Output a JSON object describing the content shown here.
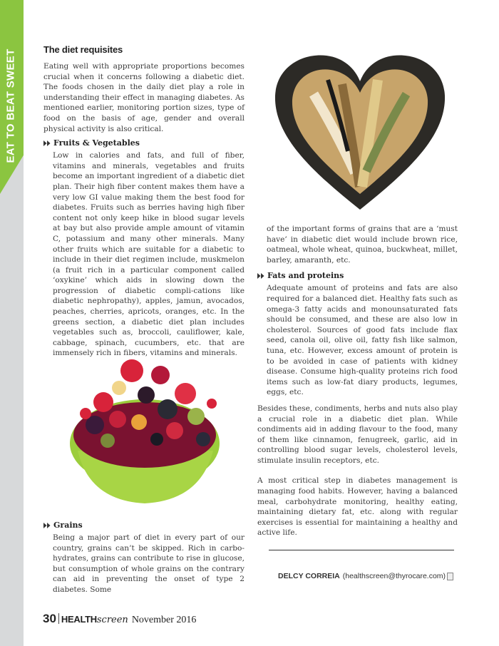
{
  "sidebar": {
    "label": "EAT TO BEAT SWEET",
    "accent_color": "#8bc540",
    "band_color": "#d7d9da"
  },
  "article": {
    "heading": "The diet requisites",
    "intro": "Eating well with appropriate proportions becomes crucial when it concerns following a diabetic diet. The foods chosen in the daily diet play a role in understanding their effect in managing diabetes. As mentioned earlier, monitoring portion sizes, type of food on the basis of age, gender and overall physical activity is also critical.",
    "fruits": {
      "title": "Fruits & Vegetables",
      "body": "Low in calories and fats, and full of fiber, vitamins and minerals, vegetables and fruits become an important ingredient of a diabetic diet plan. Their high fiber content makes them have a very low GI value making them the best food for diabetes. Fruits such as berries having high fiber content not only keep hike in blood sugar levels at bay but also provide ample amount of vitamin C, potassium and many other minerals. Many other fruits which are suitable for a diabetic to include in their diet regimen include, muskmelon (a fruit rich in a particular component called ‘oxykine’ which aids in slowing down the progression of diabetic compli-cations like diabetic nephropathy), apples, jamun, avocados, peaches, cherries, apricots, oranges, etc. In the greens section, a diabetic diet plan includes vegetables such as, broccoli, cauliflower, kale, cabbage, spinach, cucumbers, etc. that are immensely rich in fibers, vitamins and minerals."
    },
    "grains": {
      "title": "Grains",
      "body_left": "Being a major part of diet in every part of our country, grains can’t be skipped. Rich in carbo-hydrates, grains can contribute to rise in glucose, but consumption of whole grains on the contrary can aid in preventing the onset of type 2 diabetes. Some",
      "body_right": "of the important forms of grains that are a ‘must have’ in diabetic diet would include brown rice, oatmeal, whole wheat, quinoa, buckwheat, millet, barley, amaranth, etc."
    },
    "fats": {
      "title": "Fats and proteins",
      "body": "Adequate amount of proteins and fats are also required for a balanced diet. Healthy fats such as omega-3 fatty acids and monounsaturated fats should be consumed, and these are also low in cholesterol. Sources of good fats include flax seed, canola oil, olive oil, fatty fish like salmon, tuna, etc. However, excess amount of protein is to be avoided in case of patients with kidney disease. Consume high-quality proteins rich food items such as low-fat diary products, legumes, eggs, etc."
    },
    "condiments": "Besides these, condiments, herbs and nuts also play a crucial role in a diabetic diet plan. While condiments aid in adding flavour to the food, many of them like cinnamon, fenugreek, garlic, aid in controlling blood sugar levels, cholesterol levels, stimulate insulin receptors, etc.",
    "closing": "A most critical step in diabetes management is managing food habits. However, having a balanced meal, carbohydrate monitoring, healthy eating, maintaining dietary fat, etc. along with regular exercises is essential for maintaining a healthy and active life.",
    "author_name": "DELCY CORREIA",
    "author_email": "(healthscreen@thyrocare.com)"
  },
  "footer": {
    "page_number": "30",
    "magazine_bold": "HEALTH",
    "magazine_script": "screen",
    "issue": "November 2016"
  },
  "icons": {
    "bullet": "double-play-arrow-icon",
    "fruit_image": "fruit-bowl-illustration",
    "grain_image": "grain-heart-illustration"
  }
}
